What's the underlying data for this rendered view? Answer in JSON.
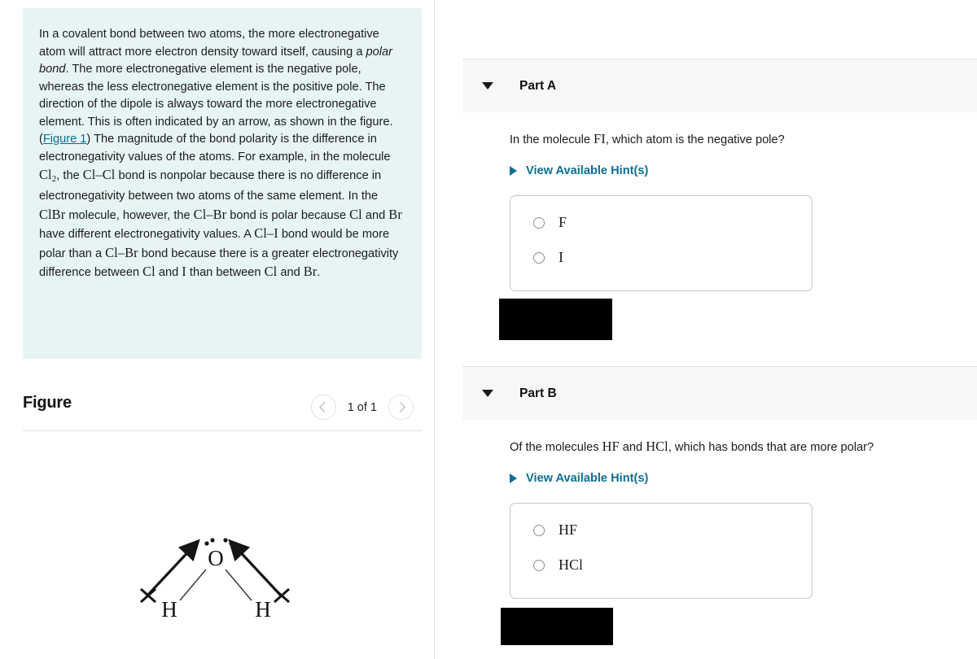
{
  "left_panel": {
    "intro": {
      "p1_a": "In a covalent bond between two atoms, the more electronegative atom will attract more electron density toward itself, causing a ",
      "p1_italic": "polar bond",
      "p1_b": ". The more electronegative element is the negative pole, whereas the less electronegative element is the positive pole. The direction of the dipole is always toward the more electronegative element. This is often indicated by an arrow, as shown in the figure. (",
      "figure_link": "Figure 1",
      "p1_c": ") The magnitude of the bond polarity is the difference in electronegativity values of the atoms. For example, in the molecule ",
      "f_cl2": "Cl",
      "f_cl2_sub": "2",
      "p1_d": ", the ",
      "f_clcl": "Cl–Cl",
      "p1_e": " bond is nonpolar because there is no difference in electronegativity between two atoms of the same element. In the ",
      "f_clbr_mol": "ClBr",
      "p1_f": " molecule, however, the ",
      "f_clbr_bond": "Cl–Br",
      "p1_g": " bond is polar because ",
      "f_cl_1": "Cl",
      "p1_h": " and ",
      "f_br_1": "Br",
      "p1_i": " have different electronegativity values. A ",
      "f_cli": "Cl–I",
      "p1_j": " bond would be more polar than a ",
      "f_clbr_bond2": "Cl–Br",
      "p1_k": " bond because there is a greater electronegativity difference between ",
      "f_cl_2": "Cl",
      "p1_l": " and ",
      "f_i_2": "I",
      "p1_m": " than between ",
      "f_cl_3": "Cl",
      "p1_n": " and ",
      "f_br_2": "Br",
      "p1_o": "."
    },
    "figure": {
      "title": "Figure",
      "page_count": "1 of 1",
      "prev_icon": "chevron-left-icon",
      "next_icon": "chevron-right-icon",
      "molecule": {
        "center_atom": "O",
        "left_atom": "H",
        "right_atom": "H"
      }
    }
  },
  "right_panel": {
    "parts": [
      {
        "header_label": "Part A",
        "disclosure_icon": "triangle-down-icon",
        "question_prefix": "In the molecule ",
        "question_formula": "FI",
        "question_suffix": ", which atom is the negative pole?",
        "hints_label": "View Available Hint(s)",
        "hints_icon": "triangle-right-icon",
        "choices": [
          "F",
          "I"
        ],
        "redaction": "redacted-answer-area"
      },
      {
        "header_label": "Part B",
        "disclosure_icon": "triangle-down-icon",
        "question_prefix": "Of the molecules ",
        "question_formula": "HF",
        "question_middle": " and ",
        "question_formula2": "HCl",
        "question_suffix": ", which has bonds that are more polar?",
        "hints_label": "View Available Hint(s)",
        "hints_icon": "triangle-right-icon",
        "choices": [
          "HF",
          "HCl"
        ],
        "redaction": "redacted-answer-area"
      }
    ]
  },
  "colors": {
    "intro_background": "#e6f5f3",
    "link": "#0b6d93",
    "hint_link": "#0d6f94",
    "part_header_background": "#f7f7f7",
    "divider": "#cfdfe5",
    "redaction": "#000000"
  }
}
